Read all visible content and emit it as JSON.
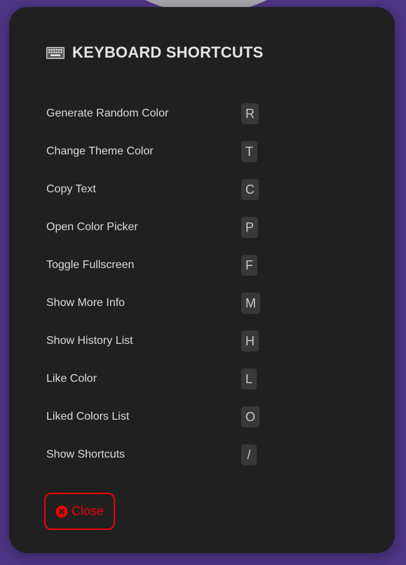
{
  "colors": {
    "page_background": "#4f3585",
    "modal_background": "#202020",
    "accent_red": "#ee0000",
    "key_background": "#383838"
  },
  "modal": {
    "icon": "keyboard-icon",
    "title": "KEYBOARD SHORTCUTS",
    "shortcuts": [
      {
        "label": "Generate Random Color",
        "key": "R"
      },
      {
        "label": "Change Theme Color",
        "key": "T"
      },
      {
        "label": "Copy Text",
        "key": "C"
      },
      {
        "label": "Open Color Picker",
        "key": "P"
      },
      {
        "label": "Toggle Fullscreen",
        "key": "F"
      },
      {
        "label": "Show More Info",
        "key": "M"
      },
      {
        "label": "Show History List",
        "key": "H"
      },
      {
        "label": "Like Color",
        "key": "L"
      },
      {
        "label": "Liked Colors List",
        "key": "O"
      },
      {
        "label": "Show Shortcuts",
        "key": "/"
      }
    ],
    "close_button": {
      "icon": "close-circle-icon",
      "label": "Close"
    }
  }
}
